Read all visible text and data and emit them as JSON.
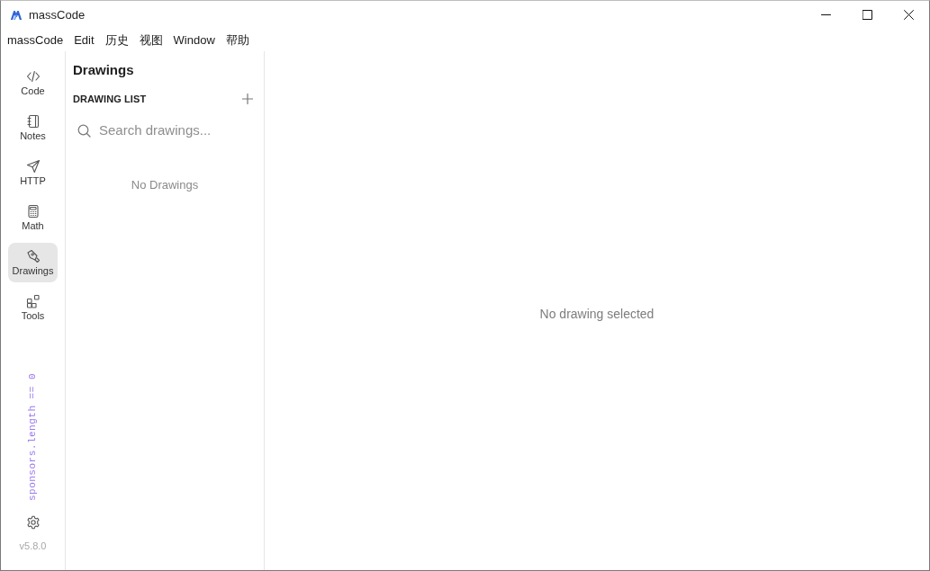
{
  "window": {
    "title": "massCode"
  },
  "menu_bar": [
    "massCode",
    "Edit",
    "历史",
    "视图",
    "Window",
    "帮助"
  ],
  "sidebar": {
    "items": [
      {
        "label": "Code",
        "selected": false
      },
      {
        "label": "Notes",
        "selected": false
      },
      {
        "label": "HTTP",
        "selected": false
      },
      {
        "label": "Math",
        "selected": false
      },
      {
        "label": "Drawings",
        "selected": true
      },
      {
        "label": "Tools",
        "selected": false
      }
    ],
    "sponsors_text": "sponsors.length == 0",
    "version": "v5.8.0"
  },
  "list_panel": {
    "title": "Drawings",
    "section_label": "DRAWING LIST",
    "search": {
      "placeholder": "Search drawings..."
    },
    "empty_text": "No Drawings"
  },
  "main": {
    "empty_text": "No drawing selected"
  }
}
